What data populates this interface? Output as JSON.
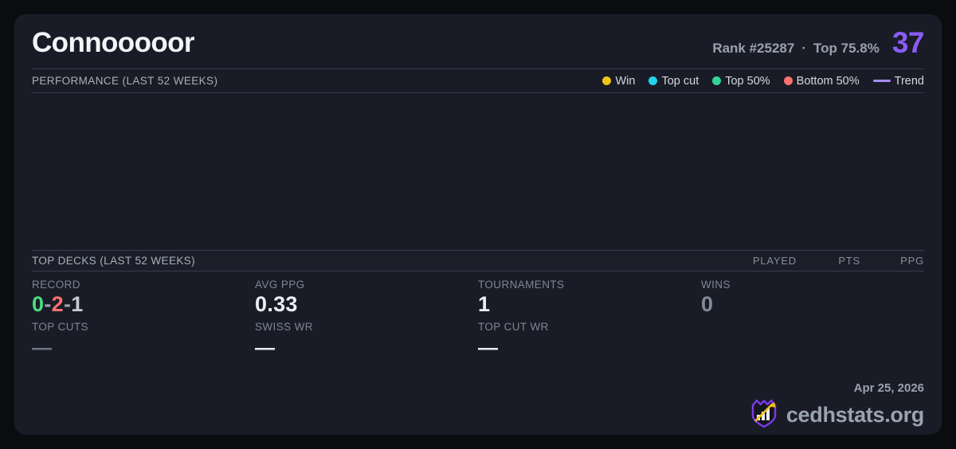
{
  "player": {
    "name": "Connooooor",
    "rank": "Rank #25287",
    "separator": "·",
    "top_percent": "Top 75.8%",
    "score": "37"
  },
  "performance": {
    "title": "PERFORMANCE (LAST 52 WEEKS)",
    "legend": [
      {
        "label": "Win",
        "color": "#f0c419"
      },
      {
        "label": "Top cut",
        "color": "#22d3ee"
      },
      {
        "label": "Top 50%",
        "color": "#34d399"
      },
      {
        "label": "Bottom 50%",
        "color": "#f87171"
      },
      {
        "label": "Trend",
        "color": "#a78bfa"
      }
    ],
    "chart_points": []
  },
  "top_decks": {
    "title": "TOP DECKS (LAST 52 WEEKS)",
    "columns": [
      "PLAYED",
      "PTS",
      "PPG"
    ],
    "rows": []
  },
  "stats": {
    "record": {
      "label": "RECORD",
      "wins": "0",
      "losses": "2",
      "draws": "1",
      "sep": "-"
    },
    "avg_ppg": {
      "label": "AVG PPG",
      "value": "0.33"
    },
    "tournaments": {
      "label": "TOURNAMENTS",
      "value": "1"
    },
    "wins": {
      "label": "WINS",
      "value": "0"
    },
    "top_cuts": {
      "label": "TOP CUTS",
      "value": "—"
    },
    "swiss_wr": {
      "label": "SWISS WR",
      "value": "—"
    },
    "top_cut_wr": {
      "label": "TOP CUT WR",
      "value": "—"
    }
  },
  "footer": {
    "date": "Apr 25, 2026",
    "brand": "cedhstats.org"
  },
  "colors": {
    "accent": "#8b5cf6",
    "win": "#4ade80",
    "loss": "#f87171",
    "draw": "#c6cad2",
    "sep": "#9aa1ad"
  }
}
